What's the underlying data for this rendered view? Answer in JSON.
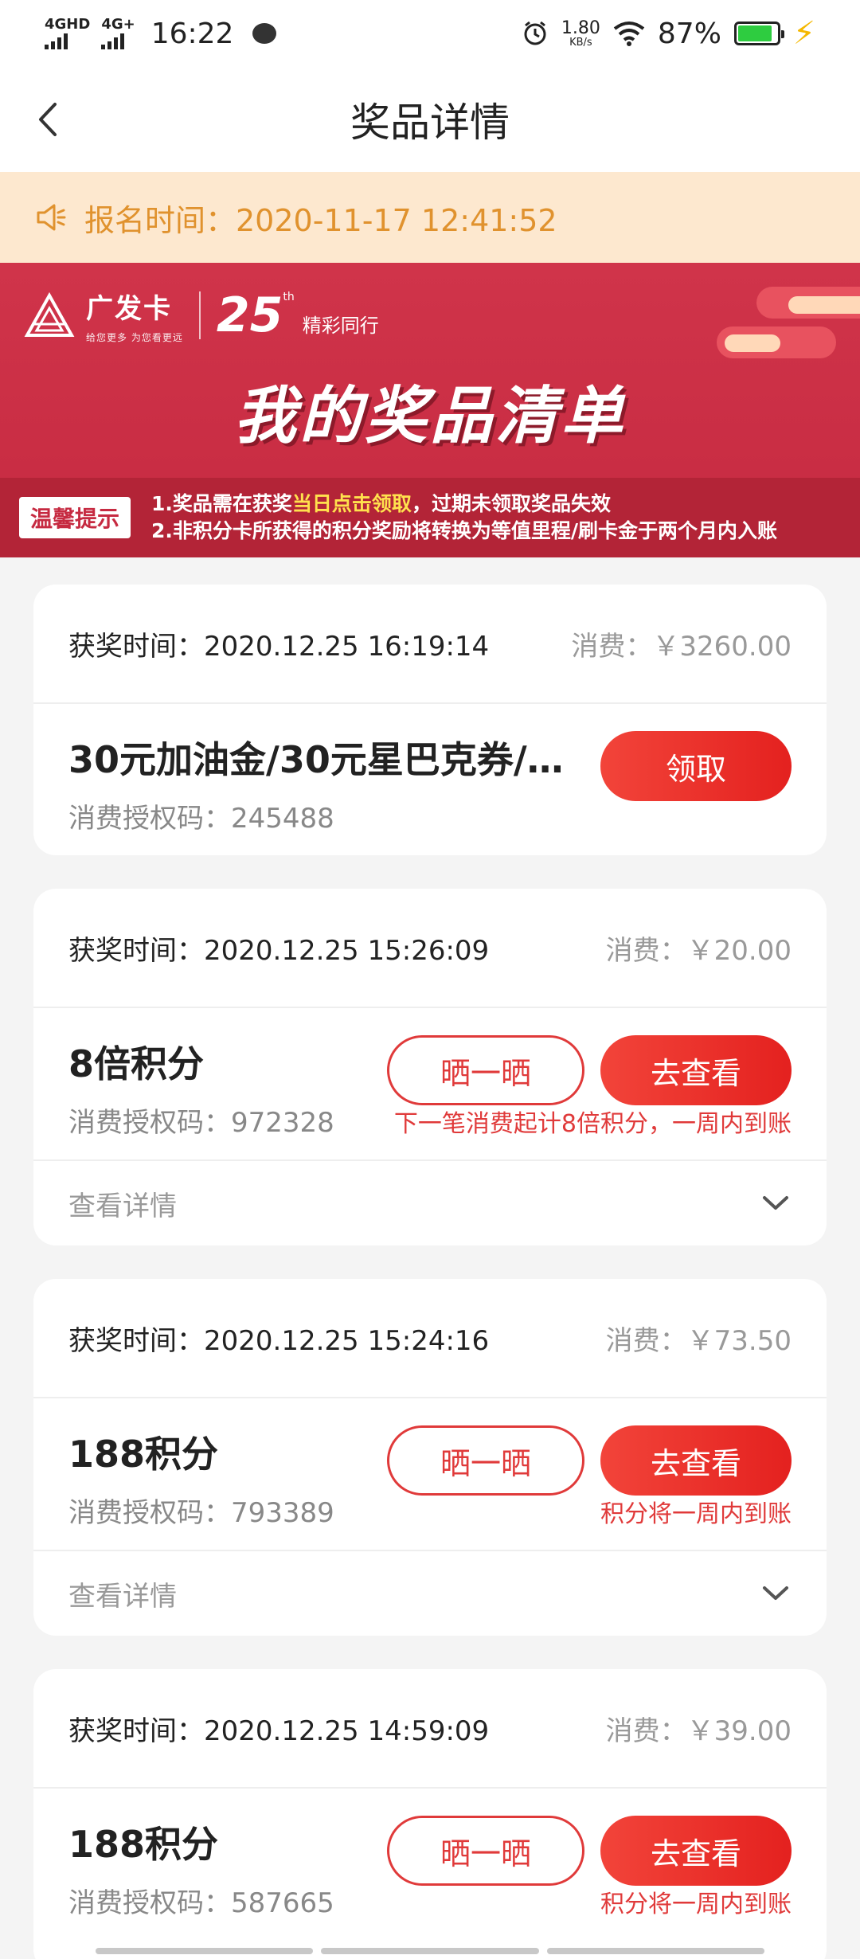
{
  "status_bar": {
    "net1": "4GHD",
    "net2": "4G+",
    "time": "16:22",
    "speed_value": "1.80",
    "speed_unit": "KB/s",
    "battery": "87%",
    "battery_level": 0.87
  },
  "header": {
    "title": "奖品详情"
  },
  "notice": {
    "text": "报名时间：2020-11-17 12:41:52"
  },
  "banner": {
    "brand": "广发卡",
    "brand_sub": "给您更多 为您看更远",
    "anniv_num": "25",
    "anniv_sup": "th",
    "anniv_text": "精彩同行",
    "title": "我的奖品清单",
    "tips_badge": "温馨提示",
    "tip1_pre": "1.奖品需在获奖",
    "tip1_hl": "当日点击领取",
    "tip1_post": "，过期未领取奖品失效",
    "tip2": "2.非积分卡所获得的积分奖励将转换为等值里程/刷卡金于两个月内入账"
  },
  "cards": [
    {
      "time": "获奖时间：2020.12.25 16:19:14",
      "spend": "消费：￥3260.00",
      "prize": "30元加油金/30元星巴克券/…",
      "auth": "消费授权码：245488",
      "primary_btn": "领取"
    },
    {
      "time": "获奖时间：2020.12.25 15:26:09",
      "spend": "消费：￥20.00",
      "prize": "8倍积分",
      "auth": "消费授权码：972328",
      "share_btn": "晒一晒",
      "primary_btn": "去查看",
      "note": "下一笔消费起计8倍积分，一周内到账",
      "details": "查看详情"
    },
    {
      "time": "获奖时间：2020.12.25 15:24:16",
      "spend": "消费：￥73.50",
      "prize": "188积分",
      "auth": "消费授权码：793389",
      "share_btn": "晒一晒",
      "primary_btn": "去查看",
      "note": "积分将一周内到账",
      "details": "查看详情"
    },
    {
      "time": "获奖时间：2020.12.25 14:59:09",
      "spend": "消费：￥39.00",
      "prize": "188积分",
      "auth": "消费授权码：587665",
      "share_btn": "晒一晒",
      "primary_btn": "去查看",
      "note": "积分将一周内到账"
    }
  ],
  "colors": {
    "accent_red": "#e4211f",
    "notice_bg": "#fde8cf",
    "notice_text": "#e0922e",
    "banner_red": "#c62a41"
  },
  "icons": [
    "signal-icon",
    "message-icon",
    "alarm-icon",
    "wifi-icon",
    "battery-icon",
    "charging-icon",
    "back-arrow-icon",
    "speaker-icon",
    "chevron-down-icon"
  ]
}
